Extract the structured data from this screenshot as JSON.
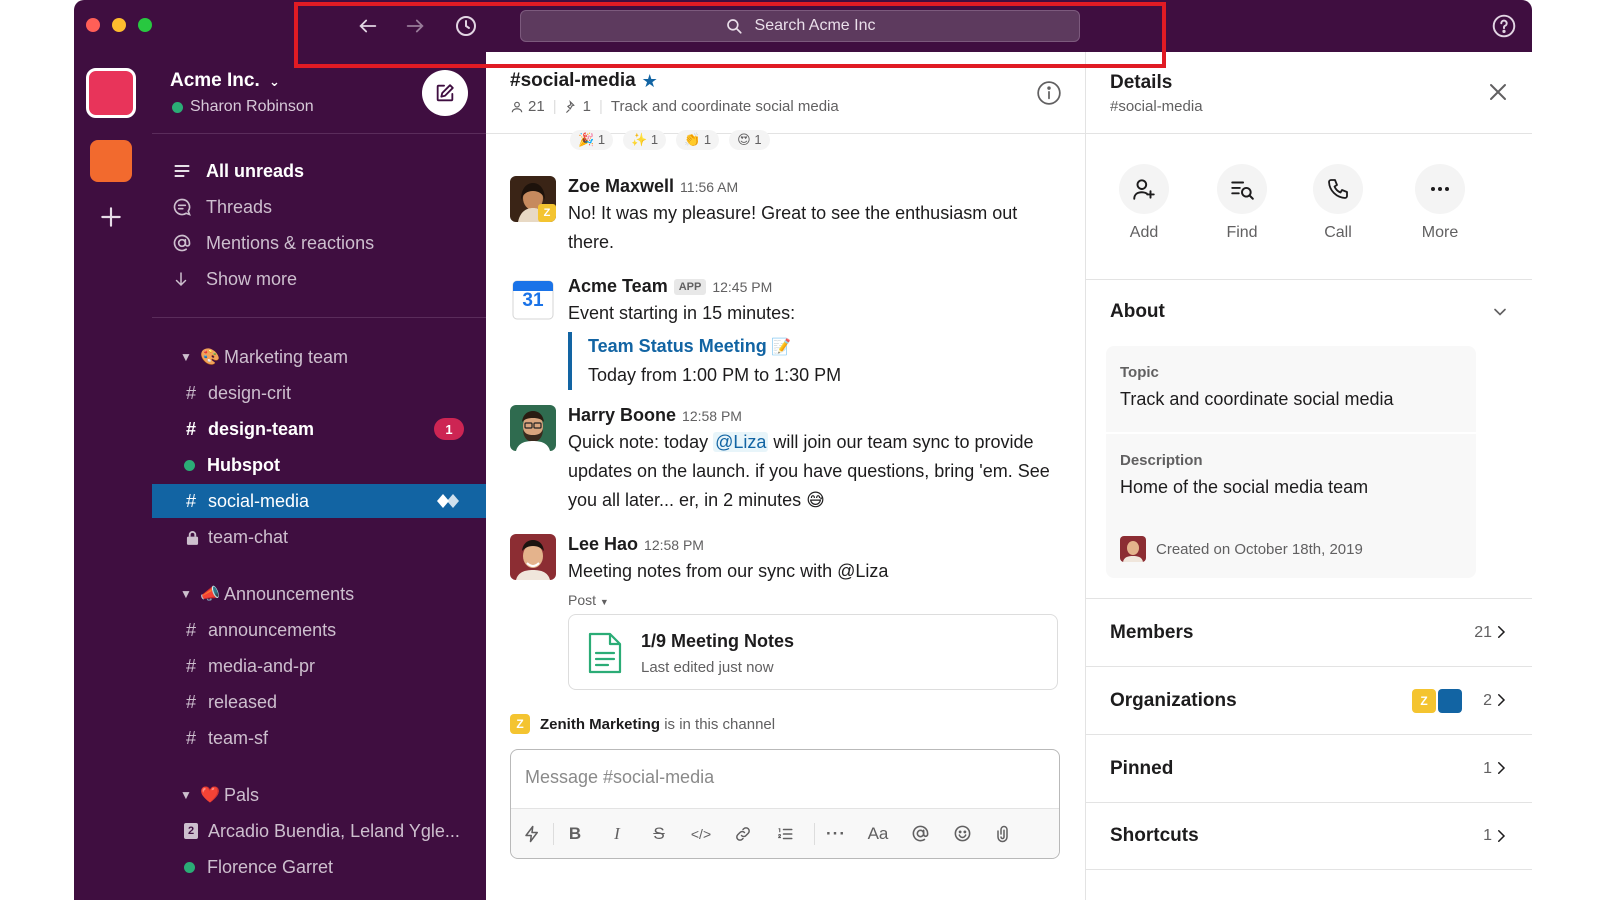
{
  "titlebar": {
    "search_placeholder": "Search Acme Inc"
  },
  "workspace": {
    "name": "Acme Inc.",
    "user": "Sharon Robinson"
  },
  "sidebar": {
    "top_items": [
      {
        "label": "All unreads",
        "icon": "list-icon"
      },
      {
        "label": "Threads",
        "icon": "threads-icon"
      },
      {
        "label": "Mentions & reactions",
        "icon": "at-icon"
      },
      {
        "label": "Show more",
        "icon": "arrow-down-icon"
      }
    ],
    "sections": [
      {
        "name": "Marketing team",
        "emoji": "🎨",
        "channels": [
          {
            "label": "design-crit"
          },
          {
            "label": "design-team",
            "badge": "1"
          },
          {
            "label": "Hubspot"
          },
          {
            "label": "social-media"
          },
          {
            "label": "team-chat"
          }
        ]
      },
      {
        "name": "Announcements",
        "emoji": "📣",
        "channels": [
          {
            "label": "announcements"
          },
          {
            "label": "media-and-pr"
          },
          {
            "label": "released"
          },
          {
            "label": "team-sf"
          }
        ]
      },
      {
        "name": "Pals",
        "emoji": "❤️",
        "channels": [
          {
            "label": "Arcadio Buendia, Leland Ygle...",
            "count": "2"
          },
          {
            "label": "Florence Garret"
          }
        ]
      }
    ]
  },
  "channel": {
    "name": "#social-media",
    "members": "21",
    "pins": "1",
    "topic": "Track and coordinate social media",
    "reactions": [
      {
        "emoji": "🎉",
        "count": "1"
      },
      {
        "emoji": "✨",
        "count": "1"
      },
      {
        "emoji": "👏",
        "count": "1"
      },
      {
        "emoji": "😍",
        "count": "1"
      }
    ],
    "messages": [
      {
        "author": "Zoe Maxwell",
        "time": "11:56 AM",
        "text": "No! It was my pleasure! Great to see the enthusiasm out there."
      },
      {
        "author": "Acme Team",
        "tag": "APP",
        "time": "12:45 PM",
        "calendar_day": "31",
        "text": "Event starting in 15 minutes:",
        "event_title": "Team Status Meeting",
        "event_emoji": "📝",
        "event_time": "Today from 1:00 PM to 1:30 PM"
      },
      {
        "author": "Harry Boone",
        "time": "12:58 PM",
        "text_before": "Quick note: today",
        "mention": "@Liza",
        "text_after": "will join our team sync to provide updates on the launch. if you have questions, bring 'em. See you all later... er, in 2 minutes",
        "emoji": "😅"
      },
      {
        "author": "Lee Hao",
        "time": "12:58 PM",
        "text": "Meeting notes from our sync with @Liza",
        "post_label": "Post",
        "post_title": "1/9 Meeting Notes",
        "post_sub": "Last edited just now"
      }
    ],
    "org_note_name": "Zenith Marketing",
    "org_note_rest": "is in this channel",
    "org_badge": "Z",
    "composer_placeholder": "Message #social-media"
  },
  "details": {
    "title": "Details",
    "subtitle": "#social-media",
    "actions": [
      {
        "label": "Add",
        "icon": "add-person-icon"
      },
      {
        "label": "Find",
        "icon": "find-icon"
      },
      {
        "label": "Call",
        "icon": "phone-icon"
      },
      {
        "label": "More",
        "icon": "more-icon"
      }
    ],
    "about_title": "About",
    "topic_label": "Topic",
    "topic_value": "Track and coordinate social media",
    "description_label": "Description",
    "description_value": "Home of the social media team",
    "created": "Created on October 18th, 2019",
    "rows": [
      {
        "label": "Members",
        "count": "21"
      },
      {
        "label": "Organizations",
        "count": "2"
      },
      {
        "label": "Pinned",
        "count": "1"
      },
      {
        "label": "Shortcuts",
        "count": "1"
      }
    ]
  },
  "colors": {
    "sidebar_bg": "#3f0e40",
    "active_channel": "#1264a3",
    "highlight_box": "#e01b24",
    "badge": "#cd2553"
  }
}
